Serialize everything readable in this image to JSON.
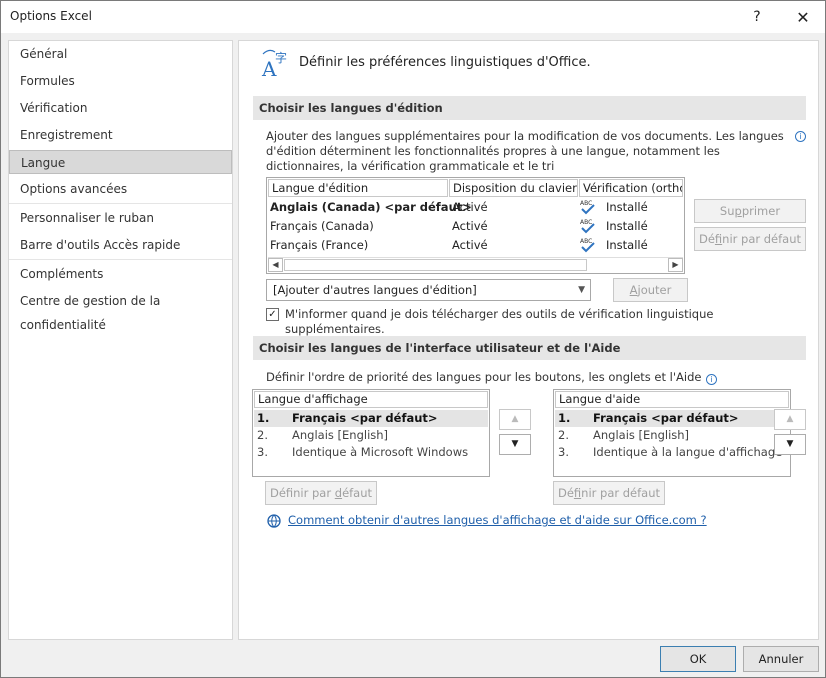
{
  "window": {
    "title": "Options Excel",
    "help_glyph": "?",
    "close_glyph": "✕"
  },
  "nav": {
    "items": [
      "Général",
      "Formules",
      "Vérification",
      "Enregistrement",
      "Langue",
      "Options avancées",
      "Personnaliser le ruban",
      "Barre d'outils Accès rapide",
      "Compléments",
      "Centre de gestion de la confidentialité"
    ],
    "active": "Langue"
  },
  "main": {
    "heading": "Définir les préférences linguistiques d'Office.",
    "editing": {
      "section_title": "Choisir les langues d'édition",
      "description": "Ajouter des langues supplémentaires pour la modification de vos documents. Les langues d'édition déterminent les fonctionnalités propres à une langue, notamment les dictionnaires, la vérification grammaticale et le tri",
      "columns": [
        "Langue d'édition",
        "Disposition du clavier",
        "Vérification (orthog"
      ],
      "rows": [
        {
          "lang": "Anglais (Canada) <par défaut>",
          "layout": "Activé",
          "proof": "Installé"
        },
        {
          "lang": "Français (Canada)",
          "layout": "Activé",
          "proof": "Installé"
        },
        {
          "lang": "Français (France)",
          "layout": "Activé",
          "proof": "Installé"
        }
      ],
      "proof_icon_text": "ABC",
      "remove_button": "Supprimer",
      "set_default_button": "Définir par défaut",
      "add_combo_value": "[Ajouter d'autres langues d'édition]",
      "add_button": "Ajouter",
      "notify_checkbox_label": "M'informer quand je dois télécharger des outils de vérification linguistique supplémentaires.",
      "notify_checked": true,
      "check_glyph": "✓",
      "scroll_left_glyph": "◀",
      "scroll_right_glyph": "▶",
      "combo_arrow_glyph": "▼"
    },
    "ui_lang": {
      "section_title": "Choisir les langues de l'interface utilisateur et de l'Aide",
      "description": "Définir l'ordre de priorité des langues pour les boutons, les onglets et l'Aide",
      "display_header": "Langue d'affichage",
      "display_items": [
        {
          "num": "1.",
          "text": "Français <par défaut>"
        },
        {
          "num": "2.",
          "text": "Anglais [English]"
        },
        {
          "num": "3.",
          "text": "Identique à Microsoft Windows"
        }
      ],
      "help_header": "Langue d'aide",
      "help_items": [
        {
          "num": "1.",
          "text": "Français <par défaut>"
        },
        {
          "num": "2.",
          "text": "Anglais [English]"
        },
        {
          "num": "3.",
          "text": "Identique à la langue d'affichage"
        }
      ],
      "set_default_button": "Définir par défaut",
      "up_glyph": "▲",
      "down_glyph": "▼",
      "link_text": "Comment obtenir d'autres langues d'affichage et d'aide sur Office.com ?",
      "info_glyph": "i"
    }
  },
  "footer": {
    "ok": "OK",
    "cancel": "Annuler"
  },
  "colors": {
    "link": "#1f5faa",
    "accent": "#2f74c0",
    "section_bg": "#e6e6e6"
  }
}
